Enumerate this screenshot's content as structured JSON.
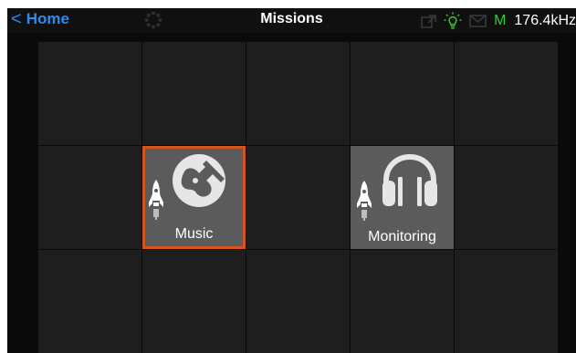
{
  "header": {
    "back_label": "Home",
    "title": "Missions",
    "status": {
      "m_label": "M",
      "sample_rate": "176.4kHz"
    }
  },
  "tiles": [
    {
      "label": "Music",
      "icon": "guitar-icon",
      "selected": true
    },
    {
      "label": "Monitoring",
      "icon": "headphones-icon",
      "selected": false
    }
  ],
  "colors": {
    "accent_blue": "#2a8bf2",
    "selection_orange": "#d4541b",
    "status_green": "#39c83b"
  }
}
